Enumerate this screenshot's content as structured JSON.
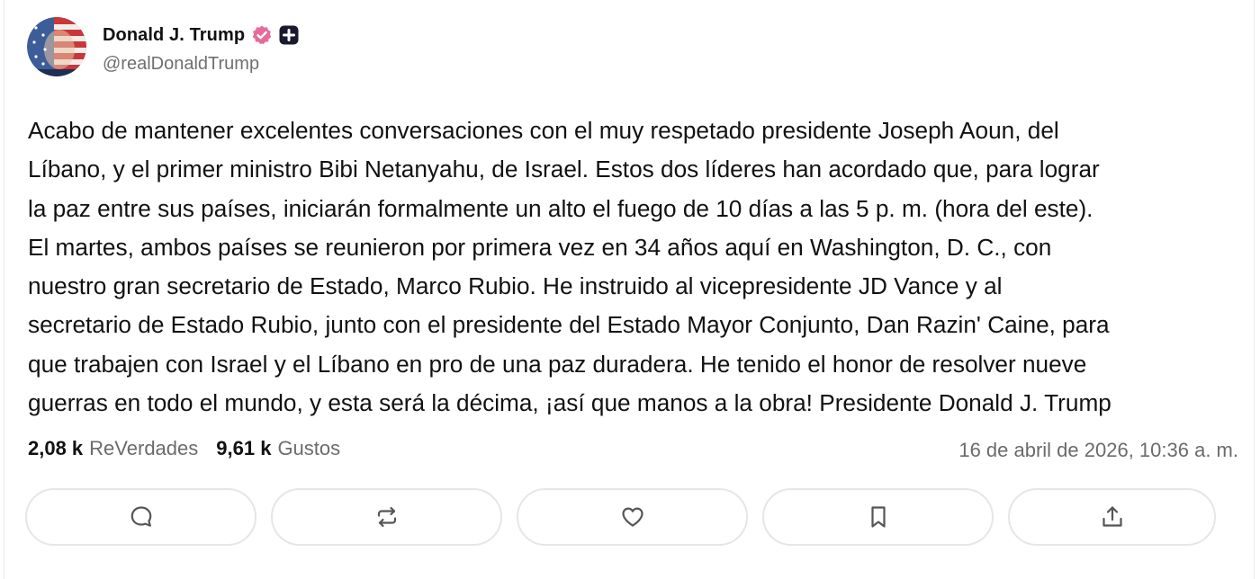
{
  "author": {
    "display_name": "Donald J. Trump",
    "handle": "@realDonaldTrump"
  },
  "post": {
    "lines": [
      "Acabo de mantener excelentes conversaciones con el muy respetado presidente Joseph Aoun, del",
      "Líbano, y el primer ministro Bibi Netanyahu, de Israel. Estos dos líderes han acordado que, para lograr",
      "la paz entre sus países, iniciarán formalmente un alto el fuego de 10 días a las 5 p. m. (hora del este).",
      "El martes, ambos países se reunieron por primera vez en 34 años aquí en Washington, D. C., con",
      "nuestro gran secretario de Estado, Marco Rubio. He instruido al vicepresidente JD Vance y al",
      "secretario de Estado Rubio, junto con el presidente del Estado Mayor Conjunto, Dan Razin' Caine, para",
      "que trabajen con Israel y el Líbano en pro de una paz duradera. He tenido el honor de resolver nueve",
      "guerras en todo el mundo, y esta será la décima, ¡así que manos a la obra! Presidente Donald J. Trump"
    ]
  },
  "stats": {
    "reposts_count": "2,08 k",
    "reposts_label": "ReVerdades",
    "likes_count": "9,61 k",
    "likes_label": "Gustos",
    "timestamp": "16 de abril de 2026, 10:36 a. m."
  },
  "actions": {
    "icons": [
      "comment-icon",
      "repost-icon",
      "heart-icon",
      "bookmark-icon",
      "share-icon"
    ]
  },
  "colors": {
    "verified_badge": "#e66b9c",
    "text_primary": "#111111",
    "text_secondary": "#6b6b6b",
    "button_border": "#e6e6e6"
  }
}
